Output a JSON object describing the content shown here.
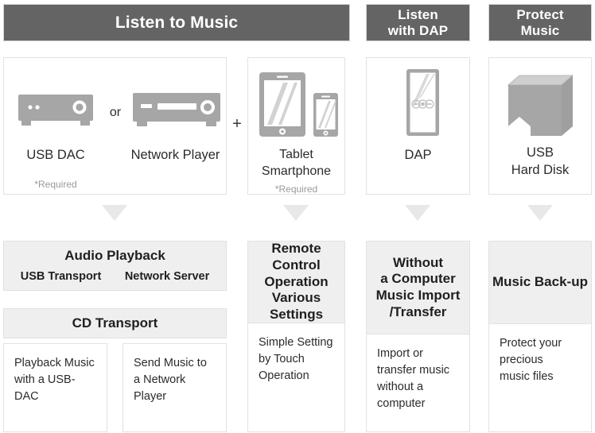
{
  "headers": [
    {
      "id": "listen-to-music",
      "text": "Listen to Music"
    },
    {
      "id": "listen-with-dap",
      "text": "Listen\nwith DAP"
    },
    {
      "id": "protect-music",
      "text": "Protect\nMusic"
    }
  ],
  "devices": {
    "usb_dac": {
      "label": "USB DAC",
      "note": "*Required",
      "icon": "usb-dac-icon"
    },
    "connector": {
      "text": "or"
    },
    "network_player": {
      "label": "Network Player",
      "note": "",
      "icon": "network-player-icon"
    },
    "plus": {
      "text": "+"
    },
    "tablet": {
      "label": "Tablet\nSmartphone",
      "note": "*Required",
      "icon": "tablet-smartphone-icon"
    },
    "dap": {
      "label": "DAP",
      "note": "",
      "icon": "dap-icon"
    },
    "hard_disk": {
      "label": "USB\nHard Disk",
      "note": "",
      "icon": "usb-hard-disk-icon"
    }
  },
  "functions": {
    "audio_playback": {
      "title": "Audio Playback",
      "items": [
        "USB Transport",
        "Network Server"
      ],
      "secondary": "CD Transport"
    },
    "remote_control": {
      "title": "Remote Control\nOperation\nVarious Settings"
    },
    "without_computer": {
      "title": "Without\na Computer\nMusic Import\n/Transfer"
    },
    "music_backup": {
      "title": "Music Back-up"
    }
  },
  "descriptions": {
    "playback_usb_dac": "Playback Music\nwith a USB-DAC",
    "send_network": "Send Music to\na Network Player",
    "simple_setting": "Simple Setting\nby Touch\nOperation",
    "import_transfer": "Import or\ntransfer music\nwithout a\ncomputer",
    "protect_files": "Protect your\nprecious\nmusic files"
  },
  "colors": {
    "banner_bg": "#646464",
    "banner_text": "#ffffff",
    "gray_block_bg": "#efefef",
    "border": "#e2e2e2",
    "arrow": "#e8e8e8",
    "icon_gray": "#a6a6a6",
    "note_text": "#9a9a9a"
  }
}
